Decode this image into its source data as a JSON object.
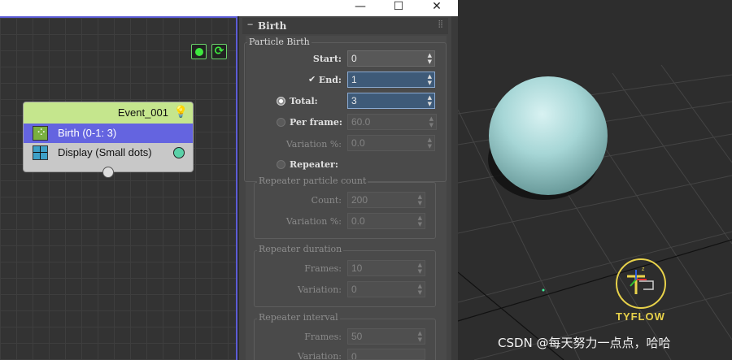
{
  "window": {
    "minimize_glyph": "—",
    "maximize_glyph": "☐",
    "close_glyph": "✕"
  },
  "editor": {
    "event": {
      "name": "Event_001",
      "operators": [
        {
          "label": "Birth (0-1: 3)",
          "icon": "birth-icon",
          "selected": true
        },
        {
          "label": "Display (Small dots)",
          "icon": "display-icon",
          "selected": false
        }
      ]
    }
  },
  "panel": {
    "rollout_title": "Birth",
    "collapse_glyph": "−",
    "section_title": "Particle Birth",
    "start": {
      "label": "Start:",
      "value": "0"
    },
    "end": {
      "label": "End:",
      "value": "1",
      "checked": true
    },
    "total": {
      "label": "Total:",
      "value": "3",
      "selected": true
    },
    "per_frame": {
      "label": "Per frame:",
      "value": "60.0"
    },
    "variation": {
      "label": "Variation %:",
      "value": "0.0"
    },
    "repeater": {
      "label": "Repeater:"
    },
    "repeater_count": {
      "title": "Repeater particle count",
      "count": {
        "label": "Count:",
        "value": "200"
      },
      "variation": {
        "label": "Variation %:",
        "value": "0.0"
      }
    },
    "repeater_duration": {
      "title": "Repeater duration",
      "frames": {
        "label": "Frames:",
        "value": "10"
      },
      "variation": {
        "label": "Variation:",
        "value": "0"
      }
    },
    "repeater_interval": {
      "title": "Repeater interval",
      "frames": {
        "label": "Frames:",
        "value": "50"
      },
      "variation": {
        "label": "Variation:",
        "value": "0"
      }
    }
  },
  "viewport": {
    "logo_text": "TYFLOW",
    "watermark": "CSDN @每天努力一点点，哈哈"
  },
  "colors": {
    "event_header": "#c5e68d",
    "selected_operator": "#6464e0",
    "sphere": "#a6d6d6",
    "active_field": "#3e5a78"
  }
}
